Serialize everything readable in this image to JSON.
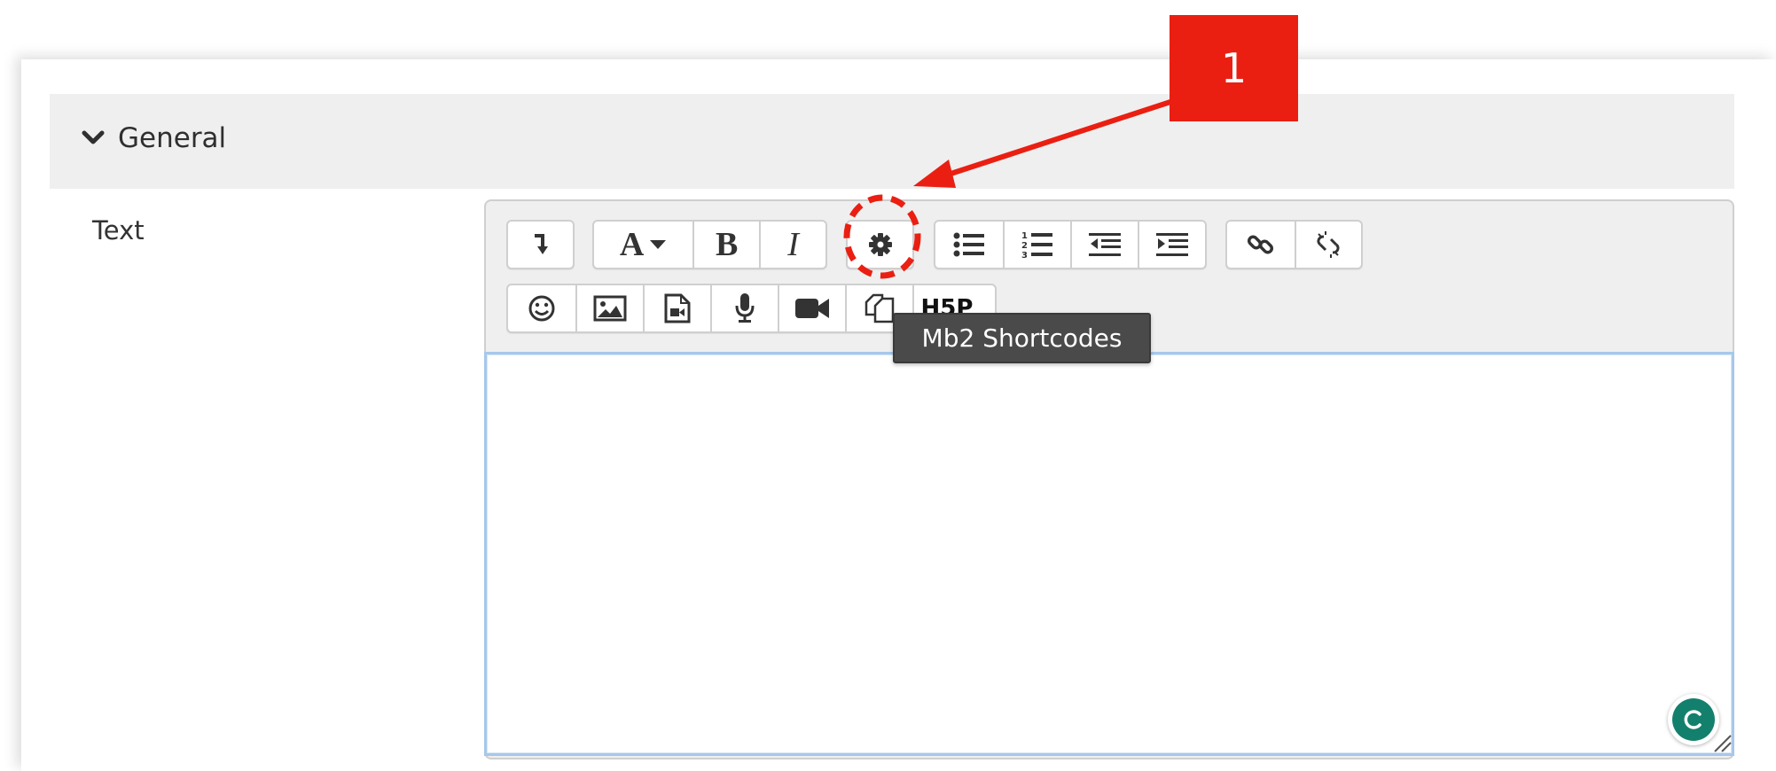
{
  "section": {
    "title": "General",
    "expanded": true
  },
  "field": {
    "label": "Text",
    "value": ""
  },
  "toolbar": {
    "row1": [
      [
        "collapse-icon"
      ],
      [
        "font-style-icon",
        "bold-icon",
        "italic-icon"
      ],
      [
        "gear-icon"
      ],
      [
        "unordered-list-icon",
        "ordered-list-icon",
        "outdent-icon",
        "indent-icon"
      ],
      [
        "link-icon",
        "unlink-icon"
      ]
    ],
    "row2": [
      [
        "emoji-icon",
        "image-icon",
        "media-icon",
        "record-audio-icon",
        "record-video-icon",
        "manage-files-icon",
        "h5p-icon"
      ]
    ],
    "font_label": "A",
    "bold_label": "B",
    "italic_label": "I",
    "h5p_label": "H5P"
  },
  "tooltip": {
    "text": "Mb2 Shortcodes"
  },
  "annotation": {
    "number": "1",
    "color": "#ea1f12"
  },
  "colors": {
    "header_bg": "#efefef",
    "editor_focus_border": "#a6c8ea",
    "grammarly": "#13806d"
  }
}
